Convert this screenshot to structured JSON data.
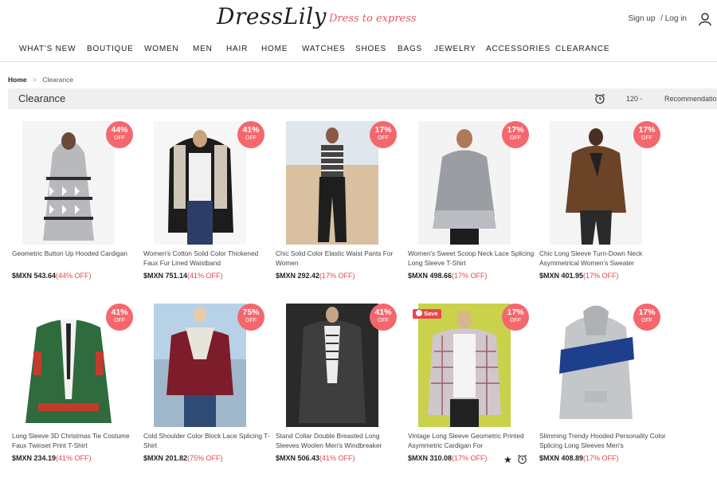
{
  "header": {
    "logo": "DressLily",
    "tagline": "Dress to express",
    "sign_up": "Sign up",
    "log_in": "/ Log in"
  },
  "nav": {
    "items": [
      "WHAT'S NEW",
      "BOUTIQUE",
      "WOMEN",
      "MEN",
      "HAIR",
      "HOME",
      "WATCHES",
      "SHOES",
      "BAGS",
      "JEWELRY",
      "ACCESSORIES",
      "CLEARANCE"
    ]
  },
  "breadcrumb": {
    "home": "Home",
    "separator": ">",
    "current": "Clearance"
  },
  "toolbar": {
    "title": "Clearance",
    "per_page": "120 -",
    "sort": "Recommendation"
  },
  "colors": {
    "badge": "#f4676d",
    "discount_text": "#e0474c",
    "tagline": "#e05a6b"
  },
  "products": [
    {
      "name": "Geometric Button Up Hooded Cardigan",
      "price": "$MXN 543.64",
      "discount": "(44% OFF)",
      "badge": "44%",
      "off": "OFF"
    },
    {
      "name": "Women's Cotton Solid Color Thickened Faux Fur Lined Waistband",
      "price": "$MXN 751.14",
      "discount": "(41% OFF)",
      "badge": "41%",
      "off": "OFF"
    },
    {
      "name": "Chic Solid Color Elastic Waist Pants For Women",
      "price": "$MXN 292.42",
      "discount": "(17% OFF)",
      "badge": "17%",
      "off": "OFF"
    },
    {
      "name": "Women's Sweet Scoop Neck Lace Splicing Long Sleeve T-Shirt",
      "price": "$MXN 498.66",
      "discount": "(17% OFF)",
      "badge": "17%",
      "off": "OFF"
    },
    {
      "name": "Chic Long Sleeve Turn-Down Neck Asymmetrical Women's Sweater",
      "price": "$MXN 401.95",
      "discount": "(17% OFF)",
      "badge": "17%",
      "off": "OFF"
    },
    {
      "name": "Long Sleeve 3D Christmas Tie Costume Faux Twinset Print T-Shirt",
      "price": "$MXN 234.19",
      "discount": "(41% OFF)",
      "badge": "41%",
      "off": "OFF"
    },
    {
      "name": "Cold Shoulder Color Block Lace Splicing T-Shirt",
      "price": "$MXN 201.82",
      "discount": "(75% OFF)",
      "badge": "75%",
      "off": "OFF"
    },
    {
      "name": "Stand Collar Double Breasted Long Sleeves Woolen Men's Windbreaker",
      "price": "$MXN 506.43",
      "discount": "(41% OFF)",
      "badge": "41%",
      "off": "OFF"
    },
    {
      "name": "Vintage Long Sleeve Geometric Printed Asymmetric Cardigan For",
      "price": "$MXN 310.08",
      "discount": "(17% OFF)",
      "badge": "17%",
      "off": "OFF",
      "save": "Save"
    },
    {
      "name": "Slimming Trendy Hooded Personality Color Splicing Long Sleeves Men's",
      "price": "$MXN 408.89",
      "discount": "(17% OFF)",
      "badge": "17%",
      "off": "OFF"
    }
  ]
}
